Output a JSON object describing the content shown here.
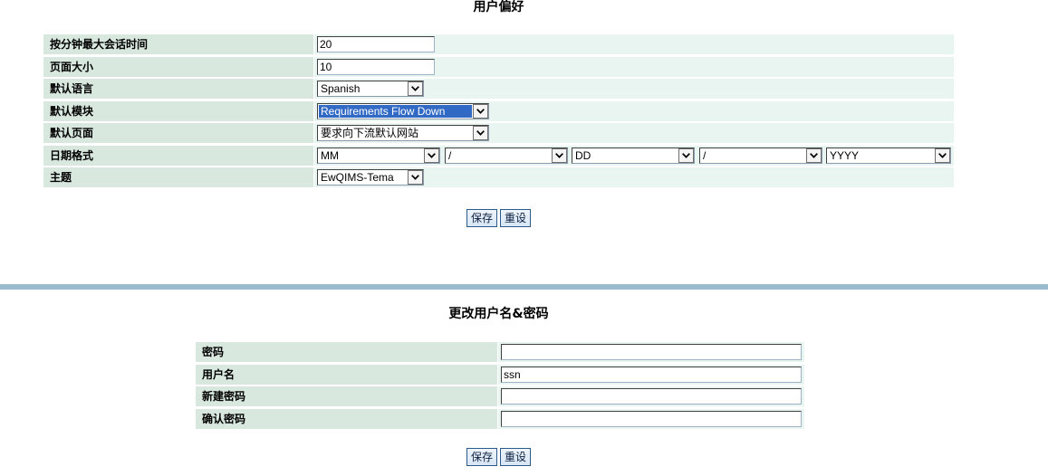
{
  "preferences": {
    "title": "用户偏好",
    "session_timeout": {
      "label": "按分钟最大会话时间",
      "value": "20"
    },
    "page_size": {
      "label": "页面大小",
      "value": "10"
    },
    "default_language": {
      "label": "默认语言",
      "selected": "Spanish"
    },
    "default_module": {
      "label": "默认模块",
      "selected": "Requirements Flow Down"
    },
    "default_page": {
      "label": "默认页面",
      "selected": "要求向下流默认网站"
    },
    "date_format": {
      "label": "日期格式",
      "parts": [
        "MM",
        "/",
        "DD",
        "/",
        "YYYY"
      ]
    },
    "theme": {
      "label": "主题",
      "selected": "EwQIMS-Tema"
    },
    "save_label": "保存",
    "reset_label": "重设"
  },
  "account": {
    "title": "更改用户名&密码",
    "password": {
      "label": "密码",
      "value": ""
    },
    "username": {
      "label": "用户名",
      "value": "ssn"
    },
    "new_password": {
      "label": "新建密码",
      "value": ""
    },
    "confirm_password": {
      "label": "确认密码",
      "value": ""
    },
    "save_label": "保存",
    "reset_label": "重设"
  },
  "icons": {
    "dropdown": "chevron-down-icon"
  },
  "colors": {
    "label_bg": "#d8e8df",
    "value_bg": "#e8f5f0",
    "divider": "#9bbcd0",
    "button_bg": "#d7e6f6",
    "button_border": "#2c5a8c",
    "focus_highlight": "#316ac5"
  }
}
